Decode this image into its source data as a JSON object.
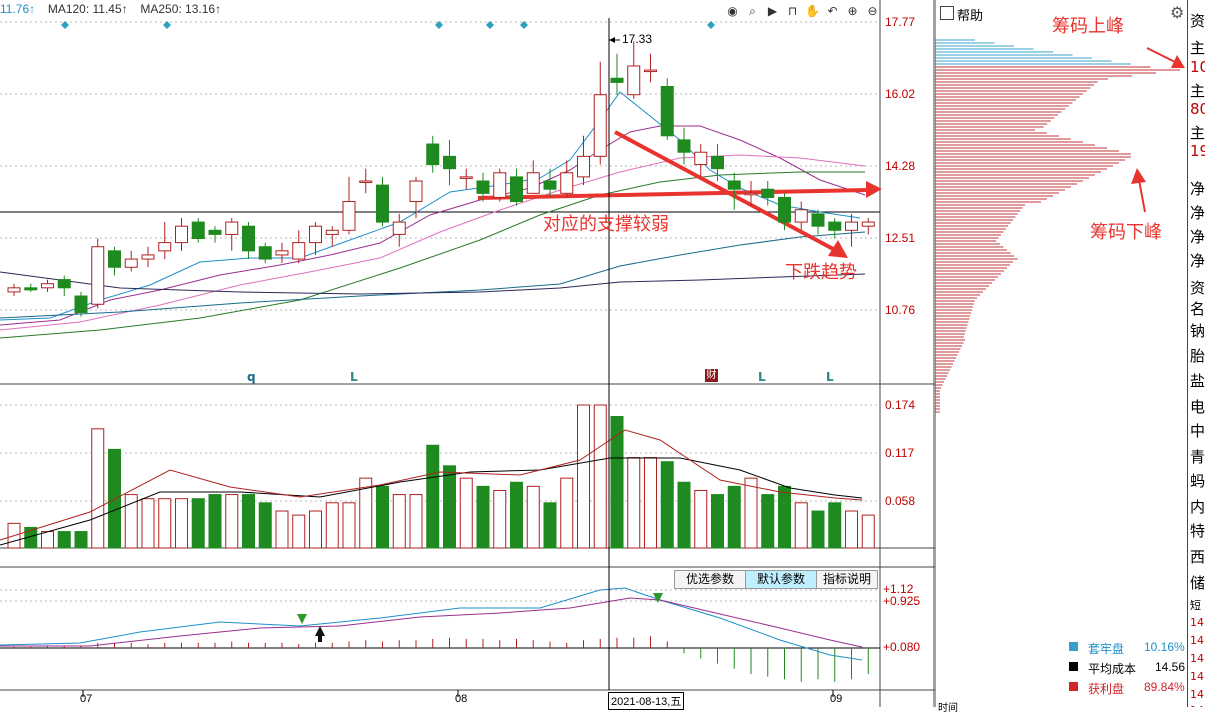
{
  "header": {
    "ma_items": [
      {
        "text": "11.76↑",
        "color": "#1e90c8"
      },
      {
        "text": "MA120: 11.45↑",
        "color": "#333333"
      },
      {
        "text": "MA250: 13.16↑",
        "color": "#333333"
      }
    ],
    "toolbar_icons": [
      "eye-icon",
      "search-icon",
      "play-icon",
      "lock-icon",
      "hand-icon",
      "undo-icon",
      "zoom-in-icon",
      "zoom-out-icon"
    ]
  },
  "price_axis": {
    "ticks": [
      "17.77",
      "16.02",
      "14.28",
      "12.51",
      "10.76"
    ],
    "ylim": [
      9.9,
      18.1
    ]
  },
  "volume_axis": {
    "ticks": [
      "0.174",
      "0.117",
      "0.058"
    ]
  },
  "macd_axis": {
    "ticks": [
      "+1.12",
      "+0.925",
      "+0.080"
    ]
  },
  "high_marker": "17.33",
  "markers": {
    "q": "q",
    "l1": "L",
    "l2": "L",
    "l3": "L",
    "fin": "财"
  },
  "macd_buttons": {
    "optional": "优选参数",
    "default": "默认参数",
    "help": "指标说明"
  },
  "x_axis": {
    "m07": "07",
    "m08": "08",
    "m09": "09",
    "cursor_date": "2021-08-13,五"
  },
  "annotations": {
    "support": "对应的支撑较弱",
    "chip_upper": "筹码上峰",
    "chip_lower": "筹码下峰",
    "trend": "下跌趋势"
  },
  "side_panel": {
    "help": "帮助",
    "gear": "gear-icon",
    "right_chars_top": [
      "资",
      "主",
      "10",
      "主",
      "80",
      "主",
      "19",
      "净",
      "净",
      "净",
      "净"
    ],
    "right_chars_bottom": [
      "资",
      "名",
      "钠",
      "胎",
      "盐",
      "电",
      "中",
      "青",
      "蚂",
      "内",
      "特",
      "西",
      "储",
      "短",
      "14",
      "14",
      "14",
      "14",
      "14",
      "14"
    ],
    "legend": [
      {
        "label": "套牢盘",
        "value": "10.16%",
        "color": "#3aa0c8"
      },
      {
        "label": "平均成本",
        "value": "14.56",
        "color": "#000000"
      },
      {
        "label": "获利盘",
        "value": "89.84%",
        "color": "#d0252b"
      }
    ],
    "bottom_text": "时间"
  },
  "chart_data": {
    "type": "candlestick",
    "candles": [
      {
        "o": 11.2,
        "c": 11.3,
        "h": 11.4,
        "l": 11.1
      },
      {
        "o": 11.3,
        "c": 11.25,
        "h": 11.4,
        "l": 11.2
      },
      {
        "o": 11.3,
        "c": 11.4,
        "h": 11.5,
        "l": 11.2
      },
      {
        "o": 11.5,
        "c": 11.3,
        "h": 11.6,
        "l": 11.1
      },
      {
        "o": 11.1,
        "c": 10.7,
        "h": 11.2,
        "l": 10.6
      },
      {
        "o": 10.9,
        "c": 12.3,
        "h": 12.5,
        "l": 10.8
      },
      {
        "o": 12.2,
        "c": 11.8,
        "h": 12.3,
        "l": 11.6
      },
      {
        "o": 11.8,
        "c": 12.0,
        "h": 12.2,
        "l": 11.7
      },
      {
        "o": 12.0,
        "c": 12.1,
        "h": 12.3,
        "l": 11.8
      },
      {
        "o": 12.2,
        "c": 12.4,
        "h": 12.9,
        "l": 12.0
      },
      {
        "o": 12.4,
        "c": 12.8,
        "h": 13.0,
        "l": 12.2
      },
      {
        "o": 12.9,
        "c": 12.5,
        "h": 13.0,
        "l": 12.4
      },
      {
        "o": 12.7,
        "c": 12.6,
        "h": 12.8,
        "l": 12.4
      },
      {
        "o": 12.6,
        "c": 12.9,
        "h": 13.0,
        "l": 12.2
      },
      {
        "o": 12.8,
        "c": 12.2,
        "h": 12.9,
        "l": 12.0
      },
      {
        "o": 12.3,
        "c": 12.0,
        "h": 12.4,
        "l": 11.9
      },
      {
        "o": 12.1,
        "c": 12.2,
        "h": 12.4,
        "l": 11.9
      },
      {
        "o": 12.0,
        "c": 12.4,
        "h": 12.7,
        "l": 11.9
      },
      {
        "o": 12.4,
        "c": 12.8,
        "h": 12.9,
        "l": 12.1
      },
      {
        "o": 12.6,
        "c": 12.7,
        "h": 12.8,
        "l": 12.3
      },
      {
        "o": 12.7,
        "c": 13.4,
        "h": 14.0,
        "l": 12.6
      },
      {
        "o": 13.9,
        "c": 13.9,
        "h": 14.2,
        "l": 13.6
      },
      {
        "o": 13.8,
        "c": 12.9,
        "h": 14.0,
        "l": 12.8
      },
      {
        "o": 12.6,
        "c": 12.9,
        "h": 13.1,
        "l": 12.3
      },
      {
        "o": 13.4,
        "c": 13.9,
        "h": 14.0,
        "l": 13.0
      },
      {
        "o": 14.8,
        "c": 14.3,
        "h": 15.0,
        "l": 14.1
      },
      {
        "o": 14.5,
        "c": 14.2,
        "h": 14.9,
        "l": 13.8
      },
      {
        "o": 14.0,
        "c": 14.0,
        "h": 14.2,
        "l": 13.7
      },
      {
        "o": 13.9,
        "c": 13.6,
        "h": 14.1,
        "l": 13.4
      },
      {
        "o": 13.5,
        "c": 14.1,
        "h": 14.2,
        "l": 13.4
      },
      {
        "o": 14.0,
        "c": 13.4,
        "h": 14.2,
        "l": 13.3
      },
      {
        "o": 13.6,
        "c": 14.1,
        "h": 14.4,
        "l": 13.6
      },
      {
        "o": 13.9,
        "c": 13.7,
        "h": 14.2,
        "l": 13.5
      },
      {
        "o": 13.6,
        "c": 14.1,
        "h": 14.4,
        "l": 13.5
      },
      {
        "o": 14.0,
        "c": 14.5,
        "h": 15.0,
        "l": 13.8
      },
      {
        "o": 14.5,
        "c": 16.0,
        "h": 16.8,
        "l": 14.3
      },
      {
        "o": 16.4,
        "c": 16.3,
        "h": 17.0,
        "l": 16.0
      },
      {
        "o": 16.0,
        "c": 16.7,
        "h": 17.3,
        "l": 15.9
      },
      {
        "o": 16.6,
        "c": 16.6,
        "h": 17.0,
        "l": 16.3
      },
      {
        "o": 16.2,
        "c": 15.0,
        "h": 16.4,
        "l": 14.9
      },
      {
        "o": 14.9,
        "c": 14.6,
        "h": 15.2,
        "l": 14.3
      },
      {
        "o": 14.3,
        "c": 14.6,
        "h": 14.8,
        "l": 14.0
      },
      {
        "o": 14.5,
        "c": 14.2,
        "h": 14.8,
        "l": 13.9
      },
      {
        "o": 13.9,
        "c": 13.7,
        "h": 14.1,
        "l": 13.2
      },
      {
        "o": 13.6,
        "c": 13.6,
        "h": 13.9,
        "l": 13.3
      },
      {
        "o": 13.7,
        "c": 13.5,
        "h": 13.9,
        "l": 13.3
      },
      {
        "o": 13.5,
        "c": 12.9,
        "h": 13.6,
        "l": 12.7
      },
      {
        "o": 12.9,
        "c": 13.2,
        "h": 13.4,
        "l": 12.7
      },
      {
        "o": 13.1,
        "c": 12.8,
        "h": 13.2,
        "l": 12.6
      },
      {
        "o": 12.9,
        "c": 12.7,
        "h": 13.0,
        "l": 12.5
      },
      {
        "o": 12.7,
        "c": 12.9,
        "h": 13.1,
        "l": 12.3
      },
      {
        "o": 12.8,
        "c": 12.9,
        "h": 13.0,
        "l": 12.6
      }
    ],
    "volume": [
      0.03,
      0.025,
      0.02,
      0.02,
      0.02,
      0.145,
      0.12,
      0.065,
      0.06,
      0.06,
      0.06,
      0.06,
      0.065,
      0.065,
      0.065,
      0.055,
      0.045,
      0.04,
      0.045,
      0.055,
      0.055,
      0.085,
      0.075,
      0.065,
      0.065,
      0.125,
      0.1,
      0.085,
      0.075,
      0.07,
      0.08,
      0.075,
      0.055,
      0.085,
      0.18,
      0.18,
      0.16,
      0.11,
      0.11,
      0.105,
      0.08,
      0.07,
      0.065,
      0.075,
      0.085,
      0.065,
      0.075,
      0.055,
      0.045,
      0.055,
      0.045,
      0.04
    ],
    "macd_hist": [
      0.005,
      0.005,
      0.01,
      0.01,
      0.01,
      0.02,
      0.02,
      0.02,
      0.015,
      0.02,
      0.02,
      0.02,
      0.02,
      0.025,
      0.02,
      0.02,
      0.02,
      0.015,
      0.02,
      0.02,
      0.025,
      0.03,
      0.025,
      0.03,
      0.03,
      0.035,
      0.04,
      0.035,
      0.035,
      0.03,
      0.035,
      0.03,
      0.025,
      0.02,
      0.03,
      0.035,
      0.04,
      0.04,
      0.045,
      0.025,
      -0.02,
      -0.04,
      -0.06,
      -0.08,
      -0.1,
      -0.11,
      -0.12,
      -0.13,
      -0.12,
      -0.13,
      -0.12,
      -0.1
    ]
  }
}
